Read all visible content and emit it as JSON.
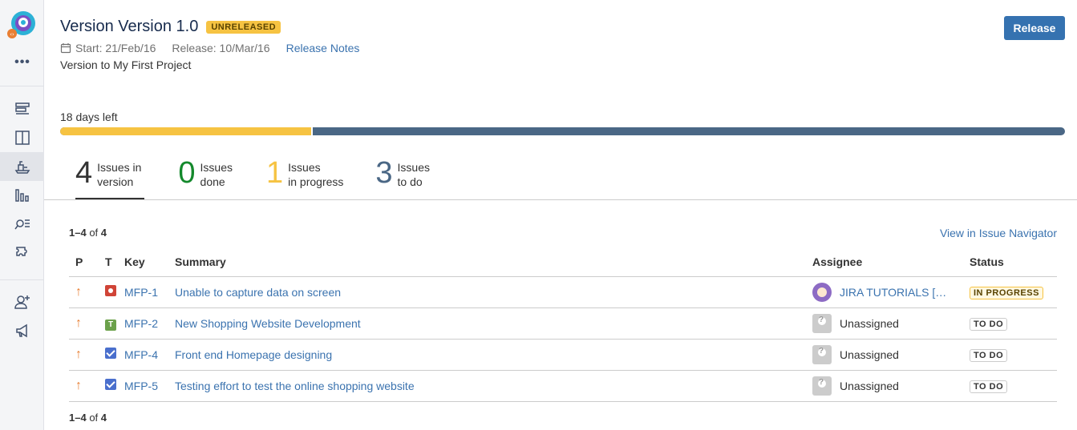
{
  "version": {
    "title": "Version Version 1.0",
    "status_lozenge": "UNRELEASED",
    "start": "Start: 21/Feb/16",
    "release": "Release: 10/Mar/16",
    "release_notes_link": "Release Notes",
    "description": "Version to My First Project",
    "release_button": "Release",
    "days_left": "18 days left",
    "progress_fraction": 0.25
  },
  "stats": [
    {
      "num": "4",
      "line1": "Issues in",
      "line2": "version",
      "color": "#333333"
    },
    {
      "num": "0",
      "line1": "Issues",
      "line2": "done",
      "color": "#14892c"
    },
    {
      "num": "1",
      "line1": "Issues",
      "line2": "in progress",
      "color": "#f6c342"
    },
    {
      "num": "3",
      "line1": "Issues",
      "line2": "to do",
      "color": "#4a6785"
    }
  ],
  "table": {
    "count_range": "1–4",
    "count_of": "of",
    "count_total": "4",
    "navigator_link": "View in Issue Navigator",
    "headers": {
      "p": "P",
      "t": "T",
      "key": "Key",
      "summary": "Summary",
      "assignee": "Assignee",
      "status": "Status"
    },
    "rows": [
      {
        "priority": "↑",
        "type": "bug",
        "key": "MFP-1",
        "summary": "Unable to capture data on screen",
        "assignee": "JIRA TUTORIALS […",
        "assignee_type": "user",
        "status": "IN PROGRESS"
      },
      {
        "priority": "↑",
        "type": "task",
        "type_letter": "T",
        "key": "MFP-2",
        "summary": "New Shopping Website Development",
        "assignee": "Unassigned",
        "assignee_type": "unassigned",
        "status": "TO DO"
      },
      {
        "priority": "↑",
        "type": "check",
        "key": "MFP-4",
        "summary": "Front end Homepage designing",
        "assignee": "Unassigned",
        "assignee_type": "unassigned",
        "status": "TO DO"
      },
      {
        "priority": "↑",
        "type": "check",
        "key": "MFP-5",
        "summary": "Testing effort to test the online shopping website",
        "assignee": "Unassigned",
        "assignee_type": "unassigned",
        "status": "TO DO"
      }
    ]
  },
  "sidebar": {
    "more": "•••",
    "icons": [
      "backlog-icon",
      "board-icon",
      "releases-icon",
      "reports-icon",
      "issues-icon",
      "components-icon",
      "add-people-icon",
      "feedback-icon"
    ]
  },
  "colors": {
    "brand": "#3572b0",
    "progress_done": "#f6c342",
    "progress_remaining": "#4a6785",
    "link": "#3b73af"
  }
}
